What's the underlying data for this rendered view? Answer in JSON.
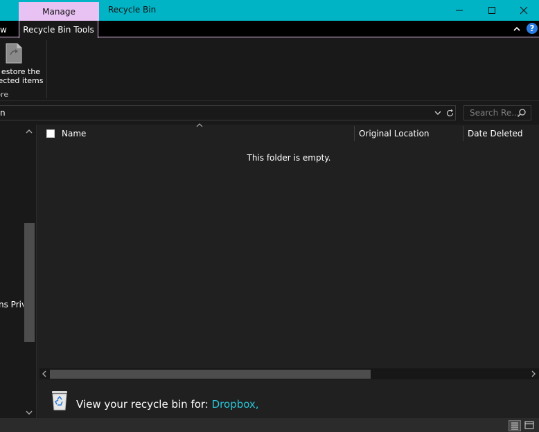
{
  "window": {
    "title": "Recycle Bin",
    "context_tab": "Manage"
  },
  "ribbon": {
    "tabs": {
      "view_fragment": "w",
      "active_tab": "Recycle Bin Tools"
    },
    "restore_button_label": "estore the\nected items",
    "group_label": "tore"
  },
  "address": {
    "text_fragment": "n",
    "search_placeholder": "Search Re..."
  },
  "nav": {
    "item_fragment": "ns Priv"
  },
  "columns": {
    "name": "Name",
    "original_location": "Original Location",
    "date_deleted": "Date Deleted"
  },
  "content": {
    "empty_message": "This folder is empty."
  },
  "footer": {
    "text": "View your recycle bin for: ",
    "link": "Dropbox,"
  },
  "colors": {
    "titlebar": "#00b4c5",
    "context_tab": "#e8c2f2",
    "link": "#2ac6d8"
  }
}
